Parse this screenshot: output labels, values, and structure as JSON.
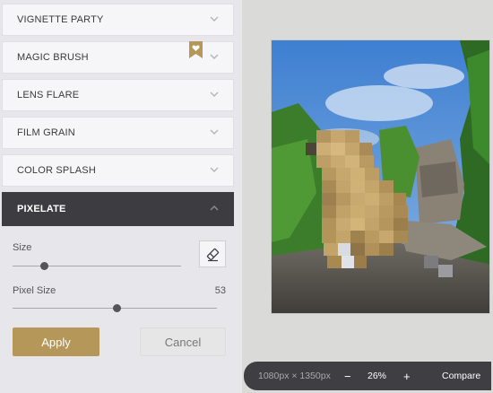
{
  "panel": {
    "sections": [
      {
        "label": "VIGNETTE PARTY"
      },
      {
        "label": "MAGIC BRUSH"
      },
      {
        "label": "LENS FLARE"
      },
      {
        "label": "FILM GRAIN"
      },
      {
        "label": "COLOR SPLASH"
      },
      {
        "label": "PIXELATE"
      }
    ],
    "controls": {
      "size_label": "Size",
      "size_level": 0.19,
      "pixel_size_label": "Pixel Size",
      "pixel_size_value": "53",
      "pixel_size_level": 0.51
    },
    "apply_label": "Apply",
    "cancel_label": "Cancel"
  },
  "toolbar": {
    "dimensions": "1080px × 1350px",
    "zoom_out": "−",
    "zoom": "26%",
    "zoom_in": "+",
    "compare": "Compare"
  },
  "colors": {
    "accent": "#b5975a",
    "active_section": "#3d3c41",
    "bottom_bar": "#3f3e43"
  },
  "icons": {
    "section_toggle": "chevron-down-icon",
    "active_toggle": "chevron-up-icon",
    "premium_badge": "heart-bookmark-icon",
    "eraser": "eraser-icon"
  }
}
